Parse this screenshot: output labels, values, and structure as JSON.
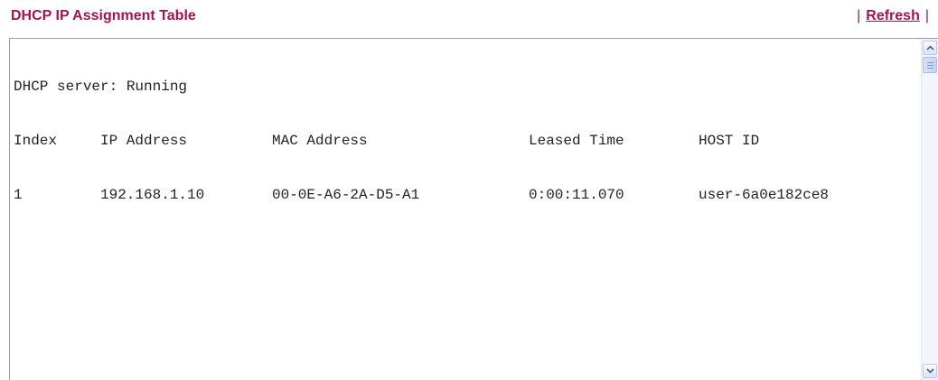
{
  "header": {
    "title": "DHCP IP Assignment Table",
    "separator_left": "|",
    "refresh_label": "Refresh",
    "separator_right": "|"
  },
  "textarea": {
    "status_line": "DHCP server: Running",
    "columns": {
      "index": "Index",
      "ip": "IP Address",
      "mac": "MAC Address",
      "leased_time": "Leased Time",
      "host_id": "HOST ID"
    },
    "rows": [
      {
        "index": "1",
        "ip": "192.168.1.10",
        "mac": "00-0E-A6-2A-D5-A1",
        "leased_time": "0:00:11.070",
        "host_id": "user-6a0e182ce8"
      }
    ]
  },
  "scrollbar": {
    "up_icon": "arrow-up-icon",
    "down_icon": "arrow-down-icon"
  },
  "colors": {
    "title": "#a3154e",
    "border": "#9c9c9c",
    "text": "#222222"
  }
}
